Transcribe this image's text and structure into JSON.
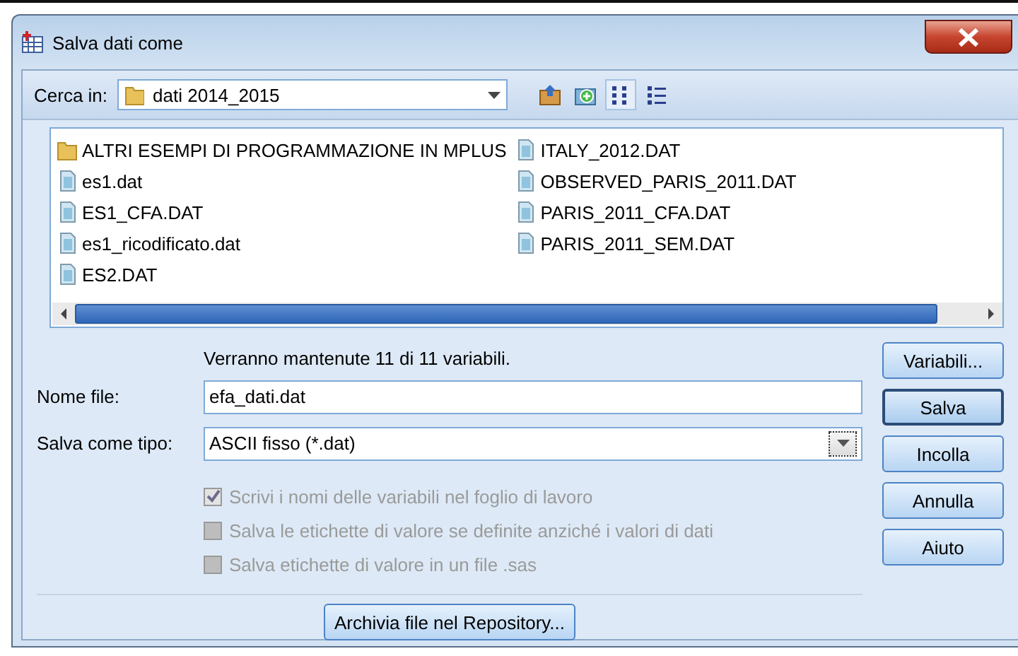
{
  "window": {
    "title": "Salva dati come"
  },
  "look_in": {
    "label": "Cerca in:",
    "value": "dati 2014_2015"
  },
  "toolbar": [
    {
      "kind": "up",
      "selected": false
    },
    {
      "kind": "new-folder",
      "selected": false
    },
    {
      "kind": "list",
      "selected": true
    },
    {
      "kind": "details",
      "selected": false
    }
  ],
  "files": [
    {
      "name": "ALTRI ESEMPI DI PROGRAMMAZIONE IN MPLUS",
      "kind": "folder"
    },
    {
      "name": "es1.dat",
      "kind": "file"
    },
    {
      "name": "ES1_CFA.DAT",
      "kind": "file"
    },
    {
      "name": "es1_ricodificato.dat",
      "kind": "file"
    },
    {
      "name": "ES2.DAT",
      "kind": "file"
    },
    {
      "name": "ITALY_2012.DAT",
      "kind": "file"
    },
    {
      "name": "OBSERVED_PARIS_2011.DAT",
      "kind": "file"
    },
    {
      "name": "PARIS_2011_CFA.DAT",
      "kind": "file"
    },
    {
      "name": "PARIS_2011_SEM.DAT",
      "kind": "file"
    }
  ],
  "message": "Verranno mantenute 11 di 11 variabili.",
  "file_name": {
    "label": "Nome file:",
    "value": "efa_dati.dat"
  },
  "file_type": {
    "label": "Salva come tipo:",
    "value": "ASCII fisso (*.dat)"
  },
  "options": [
    {
      "label": "Scrivi i nomi delle variabili nel foglio di lavoro",
      "checked": true,
      "disabled": true
    },
    {
      "label": "Salva le etichette di valore se definite anziché i valori di dati",
      "checked": false,
      "disabled": true
    },
    {
      "label": "Salva etichette di valore in un file .sas",
      "checked": false,
      "disabled": true
    }
  ],
  "repository_button": "Archivia file nel Repository...",
  "buttons": [
    {
      "label": "Variabili...",
      "default": false
    },
    {
      "label": "Salva",
      "default": true
    },
    {
      "label": "Incolla",
      "default": false
    },
    {
      "label": "Annulla",
      "default": false
    },
    {
      "label": "Aiuto",
      "default": false
    }
  ]
}
